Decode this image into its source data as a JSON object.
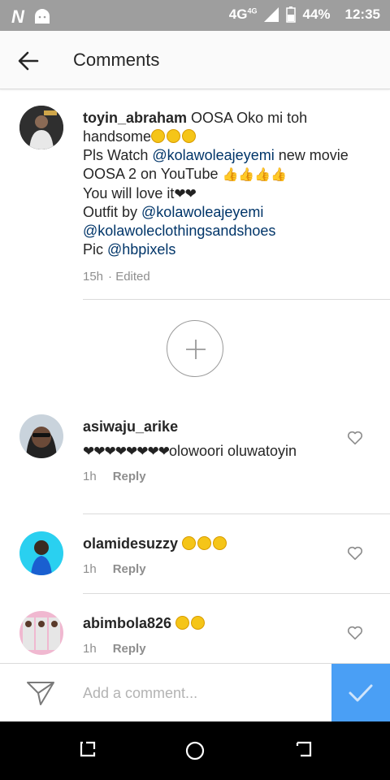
{
  "status_bar": {
    "network": "4G",
    "network_sup": "4G",
    "battery": "44%",
    "time": "12:35"
  },
  "header": {
    "title": "Comments"
  },
  "caption": {
    "username": "toyin_abraham",
    "line1": " OOSA Oko mi toh handsome",
    "line2_pre": "Pls Watch ",
    "mention1": "@kolawoleajeyemi",
    "line2_post": " new movie OOSA 2 on YouTube ",
    "line3": "You will love it",
    "line4_pre": "Outfit by ",
    "mention2": "@kolawoleajeyemi",
    "mention3": "@kolawoleclothingsandshoes",
    "line6_pre": "Pic ",
    "mention4": "@hbpixels",
    "time": "15h",
    "edited": "· Edited"
  },
  "comments": [
    {
      "username": "asiwaju_arike",
      "text": "olowoori oluwatoyin",
      "time": "1h",
      "reply": "Reply"
    },
    {
      "username": "olamidesuzzy",
      "text": "",
      "time": "1h",
      "reply": "Reply"
    },
    {
      "username": "abimbola826",
      "text": "",
      "time": "1h",
      "reply": "Reply"
    }
  ],
  "input": {
    "placeholder": "Add a comment..."
  },
  "icons": {
    "back": "arrow-left-icon",
    "load_more": "plus-icon",
    "like": "heart-outline-icon",
    "send": "paper-plane-icon",
    "post": "checkmark-icon",
    "nav": [
      "recents-icon",
      "home-icon",
      "back-icon"
    ]
  },
  "colors": {
    "accent": "#4a9ff5",
    "mention": "#003569",
    "meta": "#8e8e8e"
  }
}
